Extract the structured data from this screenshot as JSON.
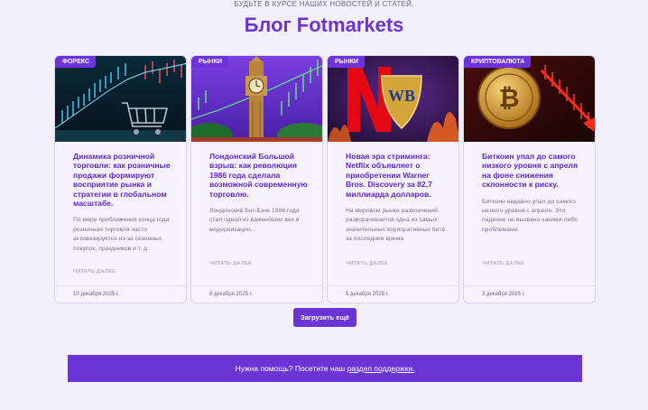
{
  "header": {
    "kicker": "БУДЬТЕ В КУРСЕ НАШИХ НОВОСТЕЙ И СТАТЕЙ.",
    "title": "Блог Fotmarkets"
  },
  "cards": [
    {
      "tag": "ФОРЕКС",
      "title": "Динамика розничной торговли: как розничные продажи формируют восприятие рынка и стратегии в глобальном масштабе.",
      "excerpt": "По мере приближения конца года розничная торговля часто активизируется из-за сезонных покупок, праздников и т. д.",
      "read_more": "ЧИТАТЬ ДАЛЕЕ",
      "date": "10 декабря 2025 г.",
      "image_icon": "shopping-cart-chart-image"
    },
    {
      "tag": "РЫНКИ",
      "title": "Лондонский Большой взрыв: как революция 1986 года сделала возможной современную торговлю.",
      "excerpt": "Лондонский Биг-Бэнк 1986 года стал одной из важнейших вех в модернизации...",
      "read_more": "ЧИТАТЬ ДАЛЕЕ",
      "date": "8 декабря 2025 г.",
      "image_icon": "big-ben-image"
    },
    {
      "tag": "РЫНКИ",
      "title": "Новая эра стриминга: Netflix объявляет о приобретении Warner Bros. Discovery за 82,7 миллиарда долларов.",
      "excerpt": "На мировом рынке развлечений разворачивается одна из самых значительных корпоративных битв за последнее время.",
      "read_more": "ЧИТАТЬ ДАЛЕЕ",
      "date": "5 декабря 2025 г.",
      "image_icon": "netflix-warner-logos-image"
    },
    {
      "tag": "КРИПТОВАЛЮТА",
      "title": "Биткоин упал до самого низкого уровня с апреля на фоне снижения склонности к риску.",
      "excerpt": "Биткоин недавно упал до самого низкого уровня с апреля. Это падение не вызвано какими-либо проблемами.",
      "read_more": "ЧИТАТЬ ДАЛЕЕ",
      "date": "3 декабря 2025 г.",
      "image_icon": "bitcoin-falling-chart-image"
    }
  ],
  "load_more_label": "Загрузить ещё",
  "help": {
    "text": "Нужна помощь? Посетите наш",
    "link": "раздел поддержки."
  }
}
